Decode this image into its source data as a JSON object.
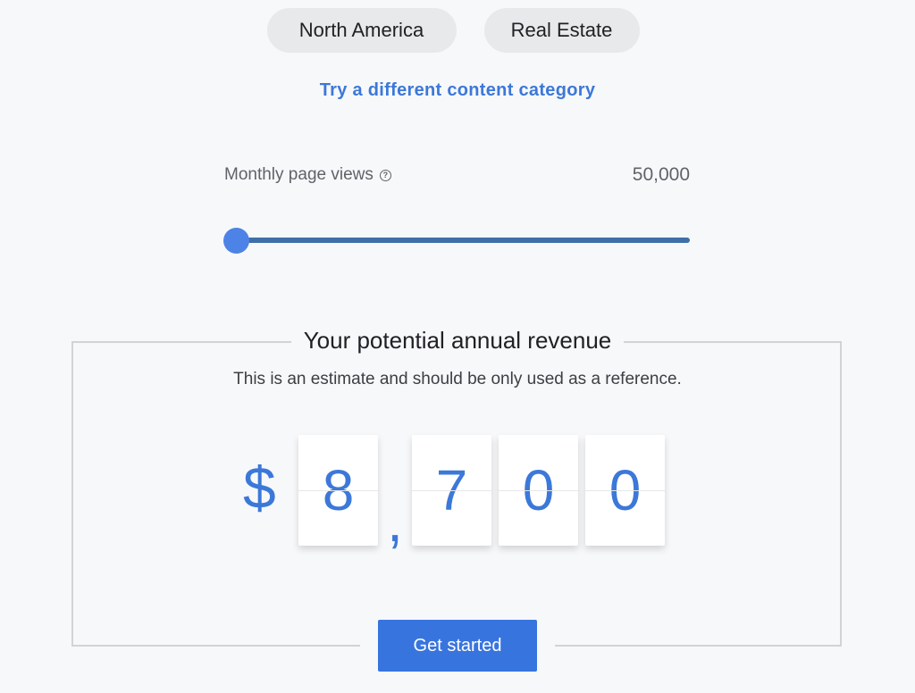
{
  "filters": {
    "region": "North America",
    "category": "Real Estate"
  },
  "change_category_link": "Try a different content category",
  "slider": {
    "label": "Monthly page views",
    "help_icon": "help-circle-icon",
    "value_display": "50,000",
    "fill_fraction": 0.0
  },
  "revenue": {
    "title": "Your potential annual revenue",
    "subtitle": "This is an estimate and should be only used as a reference.",
    "currency_symbol": "$",
    "digits": [
      "8",
      ",",
      "7",
      "0",
      "0"
    ],
    "value": "$8,700"
  },
  "cta": {
    "label": "Get started"
  },
  "colors": {
    "accent": "#3c78d8",
    "button": "#3874de",
    "slider_track": "#3f6fa8",
    "slider_thumb": "#4d83e6"
  }
}
